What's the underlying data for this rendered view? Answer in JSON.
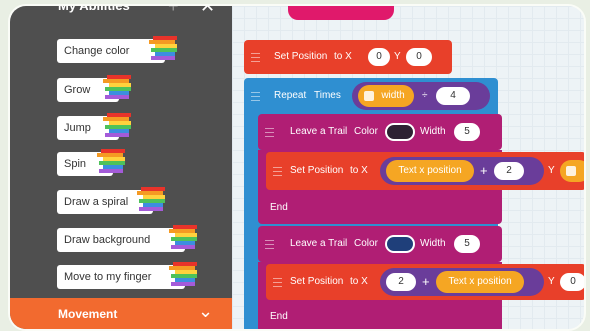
{
  "sidebar": {
    "title": "My Abilities",
    "abilities": [
      {
        "label": "Change color"
      },
      {
        "label": "Grow"
      },
      {
        "label": "Jump"
      },
      {
        "label": "Spin"
      },
      {
        "label": "Draw a spiral"
      },
      {
        "label": "Draw background"
      },
      {
        "label": "Move to my finger"
      }
    ],
    "category": "Movement"
  },
  "blocks": {
    "set_position_1": {
      "label": "Set Position",
      "to_x": "to X",
      "x": "0",
      "y_label": "Y",
      "y": "0"
    },
    "repeat": {
      "label": "Repeat",
      "times": "Times",
      "var": "width",
      "op": "÷",
      "value": "4"
    },
    "trail_1": {
      "label": "Leave a Trail",
      "color_label": "Color",
      "color": "#2e2233",
      "width_label": "Width",
      "width": "5"
    },
    "set_position_2": {
      "label": "Set Position",
      "to_x": "to X",
      "var": "Text x position",
      "op": "+",
      "value": "2",
      "y_label": "Y"
    },
    "end_1": "End",
    "trail_2": {
      "label": "Leave a Trail",
      "color_label": "Color",
      "color": "#1f3f7a",
      "width_label": "Width",
      "width": "5"
    },
    "set_position_3": {
      "label": "Set Position",
      "to_x": "to X",
      "value": "2",
      "op": "+",
      "var": "Text x position",
      "y_label": "Y",
      "y": "0"
    },
    "end_2": "End"
  },
  "colors": {
    "sidebar_bg": "#4f4f4f",
    "movement": "#f26a2f",
    "set_position": "#e8402a",
    "repeat": "#2f8fd1",
    "trail": "#b01e74",
    "variable": "#f5a623",
    "expression": "#6a3d9a"
  }
}
